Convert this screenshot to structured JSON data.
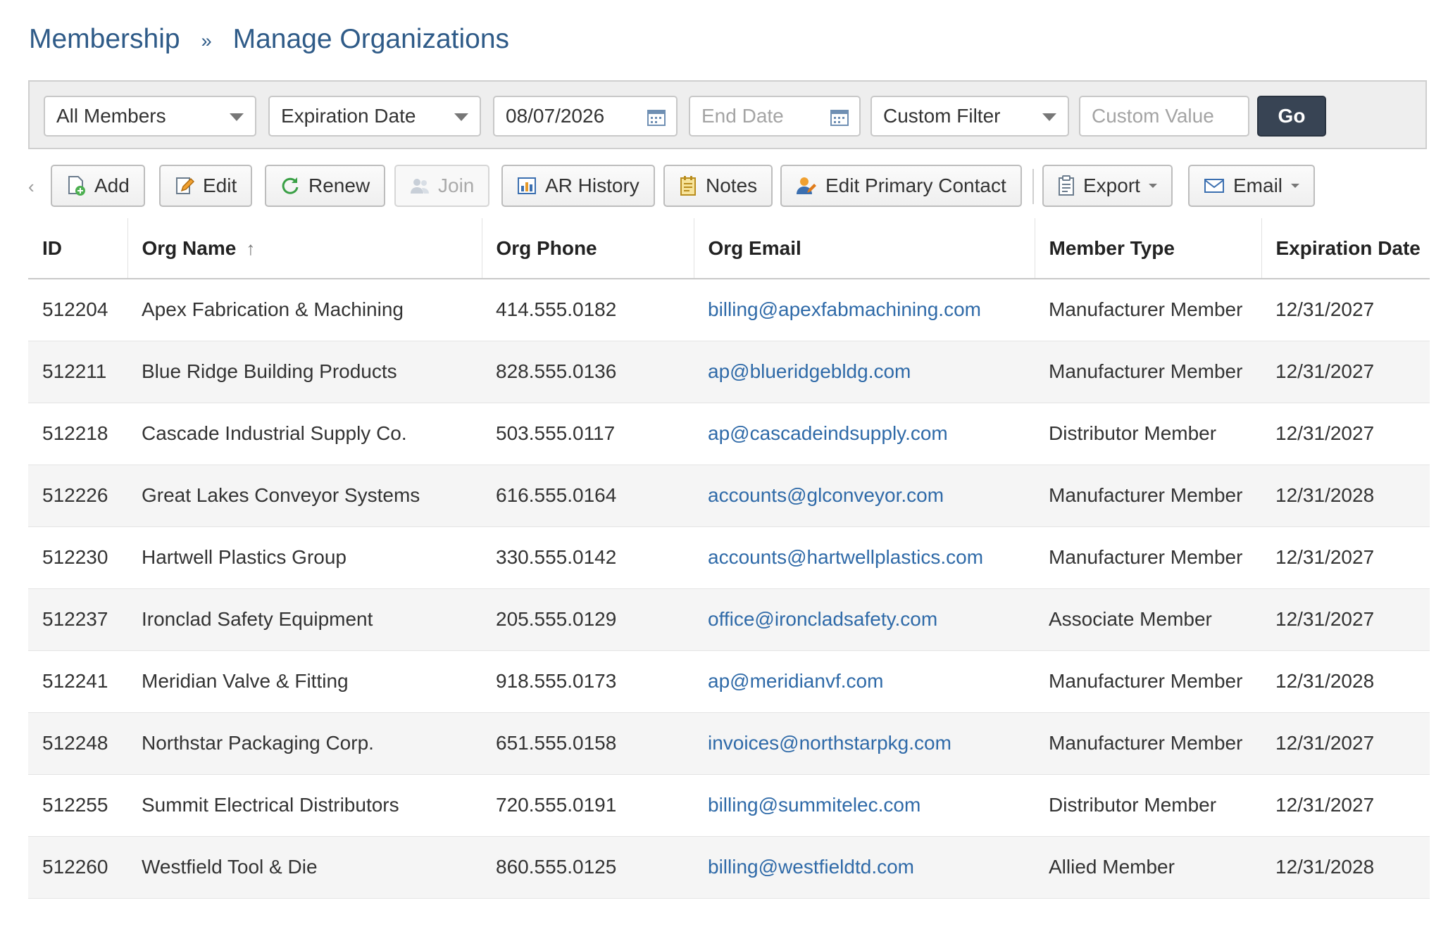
{
  "breadcrumb": {
    "parent": "Membership",
    "separator": "»",
    "current": "Manage Organizations"
  },
  "filters": {
    "member_scope": "All Members",
    "date_field": "Expiration Date",
    "start_date": "08/07/2026",
    "end_date_placeholder": "End Date",
    "custom_filter": "Custom Filter",
    "custom_value_placeholder": "Custom Value",
    "go_label": "Go"
  },
  "toolbar": {
    "scroll_left": "‹",
    "add": "Add",
    "edit": "Edit",
    "renew": "Renew",
    "join": "Join",
    "ar_history": "AR History",
    "notes": "Notes",
    "edit_primary_contact": "Edit Primary Contact",
    "export": "Export",
    "email": "Email"
  },
  "table": {
    "columns": [
      "ID",
      "Org Name",
      "Org Phone",
      "Org Email",
      "Member Type",
      "Expiration Date"
    ],
    "sort_indicator": "↑",
    "rows": [
      {
        "id": "512204",
        "name": "Apex Fabrication & Machining",
        "phone": "414.555.0182",
        "email": "billing@apexfabmachining.com",
        "type": "Manufacturer Member",
        "expires": "12/31/2027"
      },
      {
        "id": "512211",
        "name": "Blue Ridge Building Products",
        "phone": "828.555.0136",
        "email": "ap@blueridgebldg.com",
        "type": "Manufacturer Member",
        "expires": "12/31/2027"
      },
      {
        "id": "512218",
        "name": "Cascade Industrial Supply Co.",
        "phone": "503.555.0117",
        "email": "ap@cascadeindsupply.com",
        "type": "Distributor Member",
        "expires": "12/31/2027"
      },
      {
        "id": "512226",
        "name": "Great Lakes Conveyor Systems",
        "phone": "616.555.0164",
        "email": "accounts@glconveyor.com",
        "type": "Manufacturer Member",
        "expires": "12/31/2028"
      },
      {
        "id": "512230",
        "name": "Hartwell Plastics Group",
        "phone": "330.555.0142",
        "email": "accounts@hartwellplastics.com",
        "type": "Manufacturer Member",
        "expires": "12/31/2027"
      },
      {
        "id": "512237",
        "name": "Ironclad Safety Equipment",
        "phone": "205.555.0129",
        "email": "office@ironcladsafety.com",
        "type": "Associate Member",
        "expires": "12/31/2027"
      },
      {
        "id": "512241",
        "name": "Meridian Valve & Fitting",
        "phone": "918.555.0173",
        "email": "ap@meridianvf.com",
        "type": "Manufacturer Member",
        "expires": "12/31/2028"
      },
      {
        "id": "512248",
        "name": "Northstar Packaging Corp.",
        "phone": "651.555.0158",
        "email": "invoices@northstarpkg.com",
        "type": "Manufacturer Member",
        "expires": "12/31/2027"
      },
      {
        "id": "512255",
        "name": "Summit Electrical Distributors",
        "phone": "720.555.0191",
        "email": "billing@summitelec.com",
        "type": "Distributor Member",
        "expires": "12/31/2027"
      },
      {
        "id": "512260",
        "name": "Westfield Tool & Die",
        "phone": "860.555.0125",
        "email": "billing@westfieldtd.com",
        "type": "Allied Member",
        "expires": "12/31/2028"
      }
    ]
  }
}
